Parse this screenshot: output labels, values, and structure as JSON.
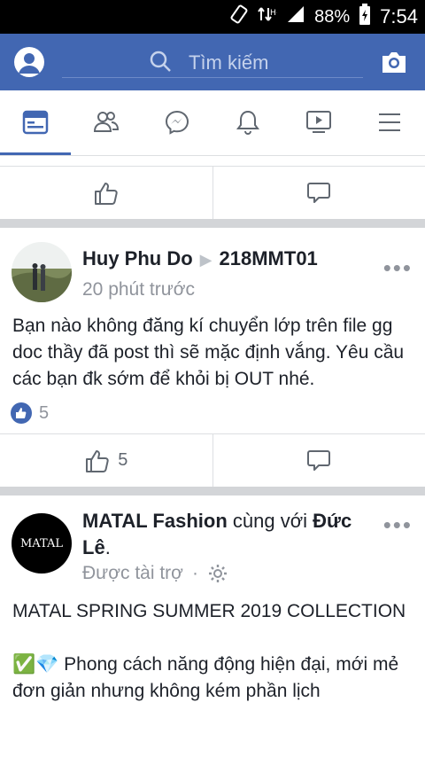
{
  "status_bar": {
    "battery": "88%",
    "time": "7:54"
  },
  "header": {
    "search_placeholder": "Tìm kiếm"
  },
  "tabs": [
    {
      "name": "news-feed",
      "active": true
    },
    {
      "name": "friends"
    },
    {
      "name": "messenger"
    },
    {
      "name": "notifications"
    },
    {
      "name": "watch"
    },
    {
      "name": "menu"
    }
  ],
  "posts": [
    {
      "author": "Huy Phu Do",
      "group": "218MMT01",
      "time": "20 phút trước",
      "text": "Bạn nào không đăng kí chuyển lớp trên file gg doc thầy đã post thì sẽ mặc định vắng. Yêu cầu các bạn đk sớm để khỏi bị OUT nhé.",
      "reaction_count": "5",
      "like_count": "5"
    },
    {
      "author": "MATAL Fashion",
      "with_text": " cùng với ",
      "with_person": "Đức Lê",
      "period": ".",
      "sponsored": "Được tài trợ",
      "dot": "·",
      "avatar_logo": "MATAL",
      "line1": "MATAL SPRING SUMMER 2019 COLLECTION",
      "line2": "✅💎 Phong cách năng động hiện đại, mới mẻ đơn giản nhưng không kém phần lịch"
    }
  ],
  "colors": {
    "brand": "#4267b2",
    "meta": "#90949c"
  }
}
